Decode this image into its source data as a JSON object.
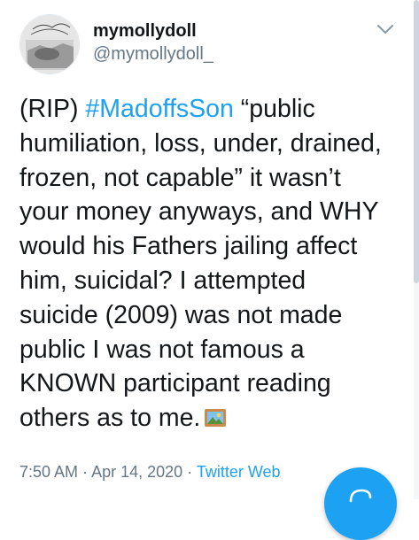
{
  "author": {
    "display_name": "mymollydoll",
    "handle": "@mymollydoll_",
    "avatar_script": "Allegory of 1961 / Peat / Bare Peat"
  },
  "tweet": {
    "lines": [
      {
        "before": "(RIP) ",
        "hashtag": "#MadoffsSon",
        "after": " “public"
      },
      {
        "text": "humiliation, loss, under, drained,"
      },
      {
        "text": "frozen, not capable” it wasn’t"
      },
      {
        "text": "your money anyways, and WHY"
      },
      {
        "text": "would his Fathers jailing affect"
      },
      {
        "text": "him, suicidal? I attempted"
      },
      {
        "text": "suicide (2009) was not made"
      },
      {
        "text": "public I was not famous a"
      },
      {
        "text": "KNOWN participant reading"
      },
      {
        "text": "others as to me."
      }
    ],
    "emoji_icon": "framed-picture-icon"
  },
  "meta": {
    "time": "7:50 AM",
    "separator": " · ",
    "date": "Apr 14, 2020",
    "source": "Twitter Web"
  },
  "icons": {
    "caret": "chevron-down-icon",
    "compose": "compose-icon"
  },
  "colors": {
    "accent": "#1da1f2",
    "text": "#14171a",
    "muted": "#657786"
  }
}
